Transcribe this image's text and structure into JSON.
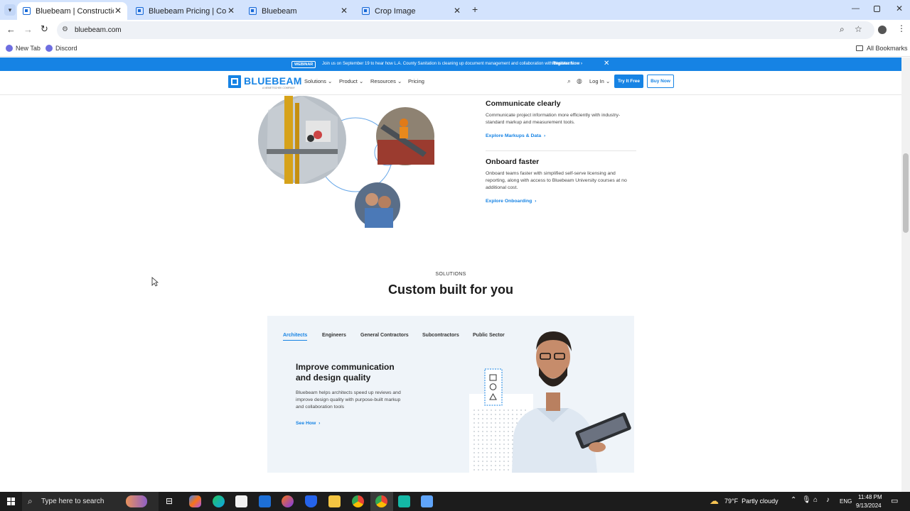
{
  "browser": {
    "tabs": [
      {
        "label": "Bluebeam | Construction Softw",
        "active": true
      },
      {
        "label": "Bluebeam Pricing | Compare Pl",
        "active": false
      },
      {
        "label": "Bluebeam",
        "active": false
      },
      {
        "label": "Crop Image",
        "active": false
      }
    ],
    "new_tab_symbol": "+",
    "url": "bluebeam.com",
    "bookmarks": [
      "New Tab",
      "Discord"
    ],
    "all_bookmarks": "All Bookmarks"
  },
  "banner": {
    "badge": "WEBINAR",
    "text": "Join us on September 19 to hear how L.A. County Sanitation is cleaning up document management and collaboration with Bluebeam.",
    "cta": "Register Now",
    "close": "✕"
  },
  "nav": {
    "logo": "BLUEBEAM",
    "logo_sub": "A NEMETSCHEK COMPANY",
    "links": [
      "Solutions",
      "Product",
      "Resources",
      "Pricing"
    ],
    "login": "Log In",
    "try_free": "Try It Free",
    "buy_now": "Buy Now"
  },
  "features": [
    {
      "title": "Communicate clearly",
      "desc": "Communicate project information more efficiently with industry-standard markup and measurement tools.",
      "link": "Explore Markups & Data"
    },
    {
      "title": "Onboard faster",
      "desc": "Onboard teams faster with simplified self-serve licensing and reporting, along with access to Bluebeam University courses at no additional cost.",
      "link": "Explore Onboarding"
    }
  ],
  "solutions": {
    "eyebrow": "SOLUTIONS",
    "heading": "Custom built for you",
    "tabs": [
      "Architects",
      "Engineers",
      "General Contractors",
      "Subcontractors",
      "Public Sector"
    ],
    "active_tab": "Architects",
    "card_title": "Improve communication and design quality",
    "card_desc": "Bluebeam helps architects speed up reviews and improve design quality with purpose-built markup and collaboration tools",
    "card_link": "See How"
  },
  "taskbar": {
    "search_placeholder": "Type here to search",
    "weather": "79°F  Partly cloudy",
    "lang": "ENG",
    "time": "11:48 PM",
    "date": "9/13/2024"
  },
  "colors": {
    "brand_blue": "#1683e4",
    "chrome_tabbar": "#d3e3fd",
    "panel_bg": "#eff4f9",
    "taskbar": "#1c1c1c"
  }
}
